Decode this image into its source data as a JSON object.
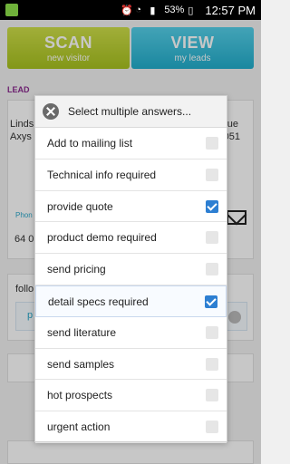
{
  "status_bar": {
    "battery_percent": "53%",
    "time": "12:57 PM"
  },
  "buttons": {
    "scan_title": "SCAN",
    "scan_subtitle": "new visitor",
    "view_title": "VIEW",
    "view_subtitle": "my leads"
  },
  "lead": {
    "section_label": "LEAD",
    "left_line1": "Linds",
    "left_line2": "Axys",
    "right_line1": "ue",
    "right_line2": "051",
    "phone_label": "Phon",
    "phone_value": "64 0"
  },
  "follow": {
    "label": "follo",
    "chip_letter": "p"
  },
  "popup": {
    "title": "Select multiple answers...",
    "options": [
      {
        "label": "Add to mailing list",
        "checked": false
      },
      {
        "label": "Technical info required",
        "checked": false
      },
      {
        "label": "provide quote",
        "checked": true
      },
      {
        "label": "product demo required",
        "checked": false
      },
      {
        "label": "send pricing",
        "checked": false
      },
      {
        "label": "detail specs required",
        "checked": true
      },
      {
        "label": "send literature",
        "checked": false
      },
      {
        "label": "send samples",
        "checked": false
      },
      {
        "label": "hot prospects",
        "checked": false
      },
      {
        "label": "urgent action",
        "checked": false
      }
    ]
  },
  "colors": {
    "scan_green": "#b5cc2b",
    "view_blue": "#2bb6d6",
    "lead_purple": "#8b2a8f",
    "checkbox_blue": "#2d7fd2"
  }
}
